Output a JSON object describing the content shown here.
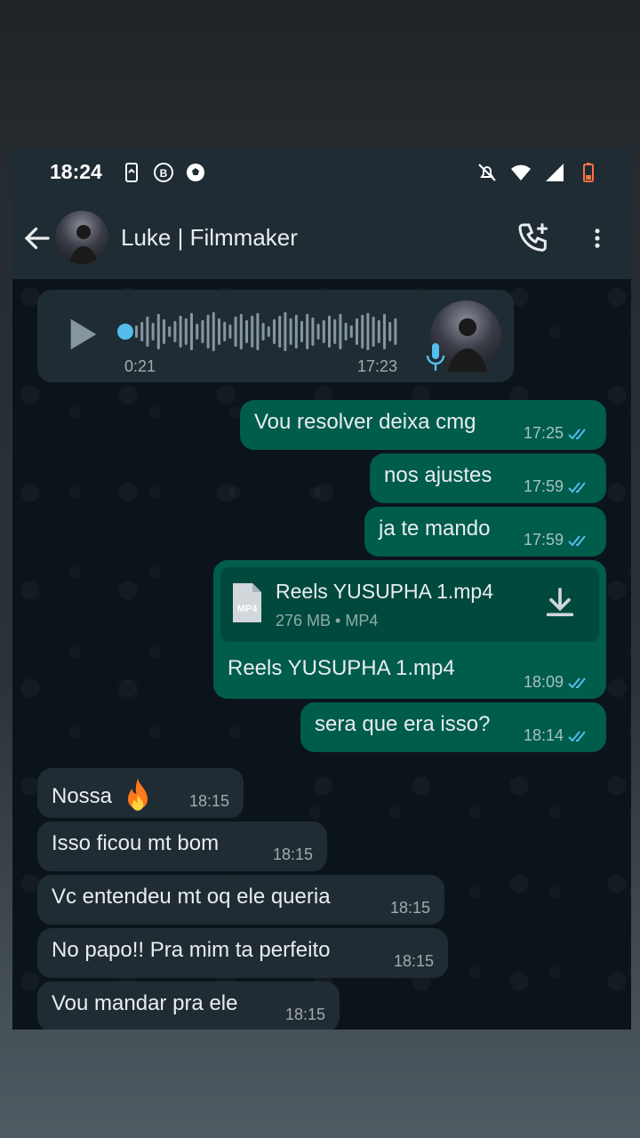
{
  "status": {
    "time": "18:24"
  },
  "header": {
    "contact_name": "Luke | Filmmaker"
  },
  "voice_message": {
    "duration": "0:21",
    "time": "17:23"
  },
  "messages": [
    {
      "text": "Vou resolver deixa cmg",
      "time": "17:25",
      "dir": "out"
    },
    {
      "text": "nos ajustes",
      "time": "17:59",
      "dir": "out"
    },
    {
      "text": "ja te mando",
      "time": "17:59",
      "dir": "out"
    },
    {
      "text": "sera que era isso?",
      "time": "18:14",
      "dir": "out"
    },
    {
      "text": "Nossa",
      "time": "18:15",
      "dir": "in"
    },
    {
      "text": "Isso ficou mt bom",
      "time": "18:15",
      "dir": "in"
    },
    {
      "text": "Vc entendeu mt oq ele queria",
      "time": "18:15",
      "dir": "in"
    },
    {
      "text": "No papo!! Pra mim ta perfeito",
      "time": "18:15",
      "dir": "in"
    },
    {
      "text": "Vou mandar pra ele",
      "time": "18:15",
      "dir": "in"
    }
  ],
  "file_message": {
    "file_name": "Reels YUSUPHA 1.mp4",
    "file_info": "276 MB • MP4",
    "file_type_badge": "MP4",
    "caption": "Reels YUSUPHA 1.mp4",
    "time": "18:09"
  },
  "colors": {
    "incoming_bubble": "#202c33",
    "outgoing_bubble": "#005c4b",
    "read_ticks": "#53bdeb",
    "header_bg": "#1f2c33"
  },
  "icons": {
    "back": "arrow-left-icon",
    "call_add": "phone-plus-icon",
    "menu": "more-vertical-icon",
    "play": "play-icon",
    "download": "download-icon",
    "mic": "mic-icon"
  }
}
